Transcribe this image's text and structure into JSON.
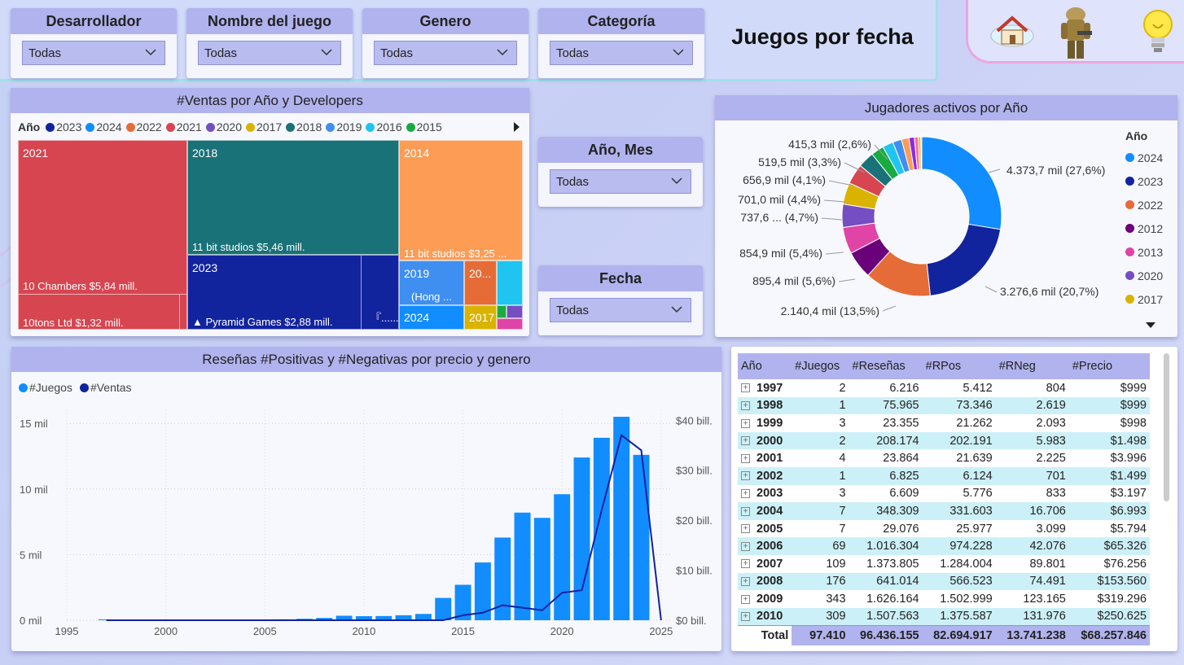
{
  "page_title": "Juegos por fecha",
  "slicers": {
    "desarrollador": {
      "title": "Desarrollador",
      "value": "Todas"
    },
    "nombre": {
      "title": "Nombre del juego",
      "value": "Todas"
    },
    "genero": {
      "title": "Genero",
      "value": "Todas"
    },
    "categoria": {
      "title": "Categoría",
      "value": "Todas"
    },
    "anio_mes": {
      "title": "Año, Mes",
      "value": "Todas"
    },
    "fecha": {
      "title": "Fecha",
      "value": "Todas"
    }
  },
  "nav_icons": [
    "home-icon",
    "soldier-character-icon",
    "lightbulb-icon"
  ],
  "treemap": {
    "title": "#Ventas por Año y Developers",
    "legend_title": "Año",
    "legend": [
      {
        "label": "2023",
        "color": "#12239e"
      },
      {
        "label": "2024",
        "color": "#118dff"
      },
      {
        "label": "2022",
        "color": "#e66c37"
      },
      {
        "label": "2021",
        "color": "#d64550"
      },
      {
        "label": "2020",
        "color": "#744ec2"
      },
      {
        "label": "2017",
        "color": "#d9b300"
      },
      {
        "label": "2018",
        "color": "#197278"
      },
      {
        "label": "2019",
        "color": "#3f8ff0"
      },
      {
        "label": "2016",
        "color": "#1fc5f0"
      },
      {
        "label": "2015",
        "color": "#1aab40"
      }
    ],
    "cells": {
      "c2021": {
        "year": "2021",
        "label1": "10 Chambers $5,84 mill.",
        "label2": "10tons Ltd $1,32 mill."
      },
      "c2018": {
        "year": "2018",
        "label1": "11 bit studios $5,46 mill."
      },
      "c2014": {
        "year": "2014",
        "label1": "11 bit studios $3,25 ..."
      },
      "c2023": {
        "year": "2023",
        "label1": "▲ Pyramid Games $2,88 mill.",
        "label2": "『......"
      },
      "c2019": {
        "year": "2019",
        "label1": "(Hong ..."
      },
      "c20x": {
        "year": "20..."
      },
      "c2024": {
        "year": "2024"
      },
      "c2017": {
        "year": "2017"
      }
    }
  },
  "donut": {
    "title": "Jugadores activos por Año",
    "legend_title": "Año",
    "legend": [
      {
        "label": "2024",
        "color": "#118dff"
      },
      {
        "label": "2023",
        "color": "#12239e"
      },
      {
        "label": "2022",
        "color": "#e66c37"
      },
      {
        "label": "2012",
        "color": "#6b007b"
      },
      {
        "label": "2013",
        "color": "#e044a7"
      },
      {
        "label": "2020",
        "color": "#744ec2"
      },
      {
        "label": "2017",
        "color": "#d9b300"
      }
    ],
    "labels": [
      "4.373,7 mil (27,6%)",
      "3.276,6 mil (20,7%)",
      "2.140,4 mil (13,5%)",
      "895,4 mil (5,6%)",
      "854,9 mil (5,4%)",
      "737,6 ... (4,7%)",
      "701,0 mil (4,4%)",
      "656,9 mil (4,1%)",
      "519,5 mil (3,3%)",
      "415,3 mil (2,6%)"
    ]
  },
  "chart_data": {
    "type": "bar",
    "title": "Reseñas #Positivas y #Negativas por precio y genero",
    "series": [
      {
        "name": "#Juegos",
        "type": "bar",
        "color": "#118dff",
        "axis": "left",
        "x": [
          1997,
          1998,
          1999,
          2000,
          2001,
          2002,
          2003,
          2004,
          2005,
          2006,
          2007,
          2008,
          2009,
          2010,
          2011,
          2012,
          2013,
          2014,
          2015,
          2016,
          2017,
          2018,
          2019,
          2020,
          2021,
          2022,
          2023,
          2024
        ],
        "values": [
          2,
          1,
          3,
          2,
          4,
          1,
          3,
          7,
          7,
          69,
          109,
          176,
          343,
          309,
          320,
          380,
          480,
          1700,
          2700,
          4400,
          6300,
          8200,
          7800,
          9600,
          12400,
          13900,
          15500,
          12600
        ]
      },
      {
        "name": "#Ventas",
        "type": "line",
        "color": "#12239e",
        "axis": "right",
        "x": [
          1997,
          1998,
          1999,
          2000,
          2001,
          2002,
          2003,
          2004,
          2005,
          2006,
          2007,
          2008,
          2009,
          2010,
          2011,
          2012,
          2013,
          2014,
          2015,
          2016,
          2017,
          2018,
          2019,
          2020,
          2021,
          2022,
          2023,
          2024,
          2025
        ],
        "values": [
          0,
          0,
          0,
          0,
          0,
          0,
          0,
          0,
          0,
          0,
          0,
          0,
          0,
          0,
          0,
          0,
          0,
          0,
          1,
          1.5,
          3,
          2.5,
          2,
          5.5,
          6,
          22,
          37,
          34,
          0
        ]
      }
    ],
    "y_left_ticks": [
      "0 mil",
      "5 mil",
      "10 mil",
      "15 mil"
    ],
    "y_right_ticks": [
      "$0 bill.",
      "$10 bill.",
      "$20 bill.",
      "$30 bill.",
      "$40 bill."
    ],
    "x_ticks": [
      "1995",
      "2000",
      "2005",
      "2010",
      "2015",
      "2020",
      "2025"
    ],
    "ylim_left": [
      0,
      16000
    ],
    "ylim_right": [
      0,
      42
    ],
    "xlim": [
      1995,
      2025.5
    ]
  },
  "table": {
    "headers": [
      "Año",
      "#Juegos",
      "#Reseñas",
      "#RPos",
      "#RNeg",
      "#Precio"
    ],
    "rows": [
      [
        "1997",
        "2",
        "6.216",
        "5.412",
        "804",
        "$999"
      ],
      [
        "1998",
        "1",
        "75.965",
        "73.346",
        "2.619",
        "$999"
      ],
      [
        "1999",
        "3",
        "23.355",
        "21.262",
        "2.093",
        "$998"
      ],
      [
        "2000",
        "2",
        "208.174",
        "202.191",
        "5.983",
        "$1.498"
      ],
      [
        "2001",
        "4",
        "23.864",
        "21.639",
        "2.225",
        "$3.996"
      ],
      [
        "2002",
        "1",
        "6.825",
        "6.124",
        "701",
        "$1.499"
      ],
      [
        "2003",
        "3",
        "6.609",
        "5.776",
        "833",
        "$3.197"
      ],
      [
        "2004",
        "7",
        "348.309",
        "331.603",
        "16.706",
        "$6.993"
      ],
      [
        "2005",
        "7",
        "29.076",
        "25.977",
        "3.099",
        "$5.794"
      ],
      [
        "2006",
        "69",
        "1.016.304",
        "974.228",
        "42.076",
        "$65.326"
      ],
      [
        "2007",
        "109",
        "1.373.805",
        "1.284.004",
        "89.801",
        "$76.256"
      ],
      [
        "2008",
        "176",
        "641.014",
        "566.523",
        "74.491",
        "$153.560"
      ],
      [
        "2009",
        "343",
        "1.626.164",
        "1.502.999",
        "123.165",
        "$319.296"
      ],
      [
        "2010",
        "309",
        "1.507.563",
        "1.375.587",
        "131.976",
        "$250.625"
      ]
    ],
    "total": [
      "Total",
      "97.410",
      "96.436.155",
      "82.694.917",
      "13.741.238",
      "$68.257.846"
    ]
  }
}
